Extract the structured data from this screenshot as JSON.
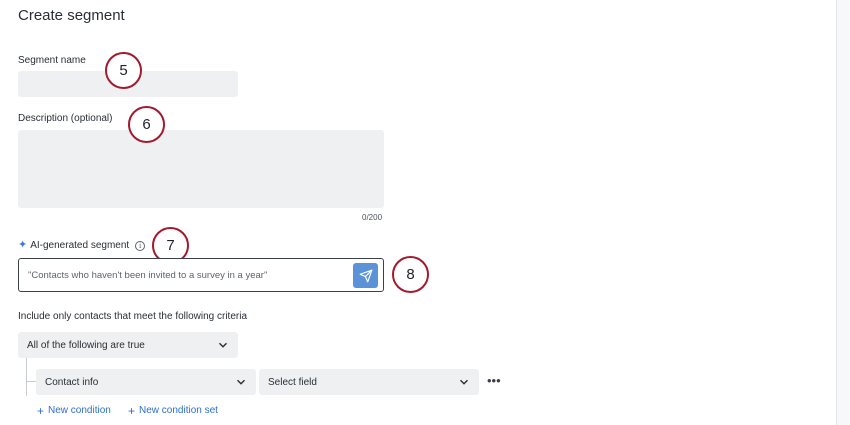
{
  "page": {
    "title": "Create segment"
  },
  "segment_name": {
    "label": "Segment name",
    "value": ""
  },
  "description": {
    "label": "Description (optional)",
    "value": "",
    "counter": "0/200"
  },
  "ai_segment": {
    "label": "AI-generated segment",
    "placeholder": "\"Contacts who haven't been invited to a survey in a year\"",
    "sparkle_icon": "sparkle-icon",
    "info_icon": "info-icon",
    "send_icon": "send-icon"
  },
  "criteria": {
    "label": "Include only contacts that meet the following criteria",
    "match_select": "All of the following are true",
    "condition": {
      "field_type": "Contact info",
      "field": "Select field"
    },
    "new_condition": "New condition",
    "new_condition_set": "New condition set"
  },
  "callouts": [
    "5",
    "6",
    "7",
    "8"
  ],
  "colors": {
    "callout_border": "#a3192d",
    "send_button": "#5b93d8",
    "link": "#2f6fd0",
    "field_bg": "#eef0f2"
  }
}
